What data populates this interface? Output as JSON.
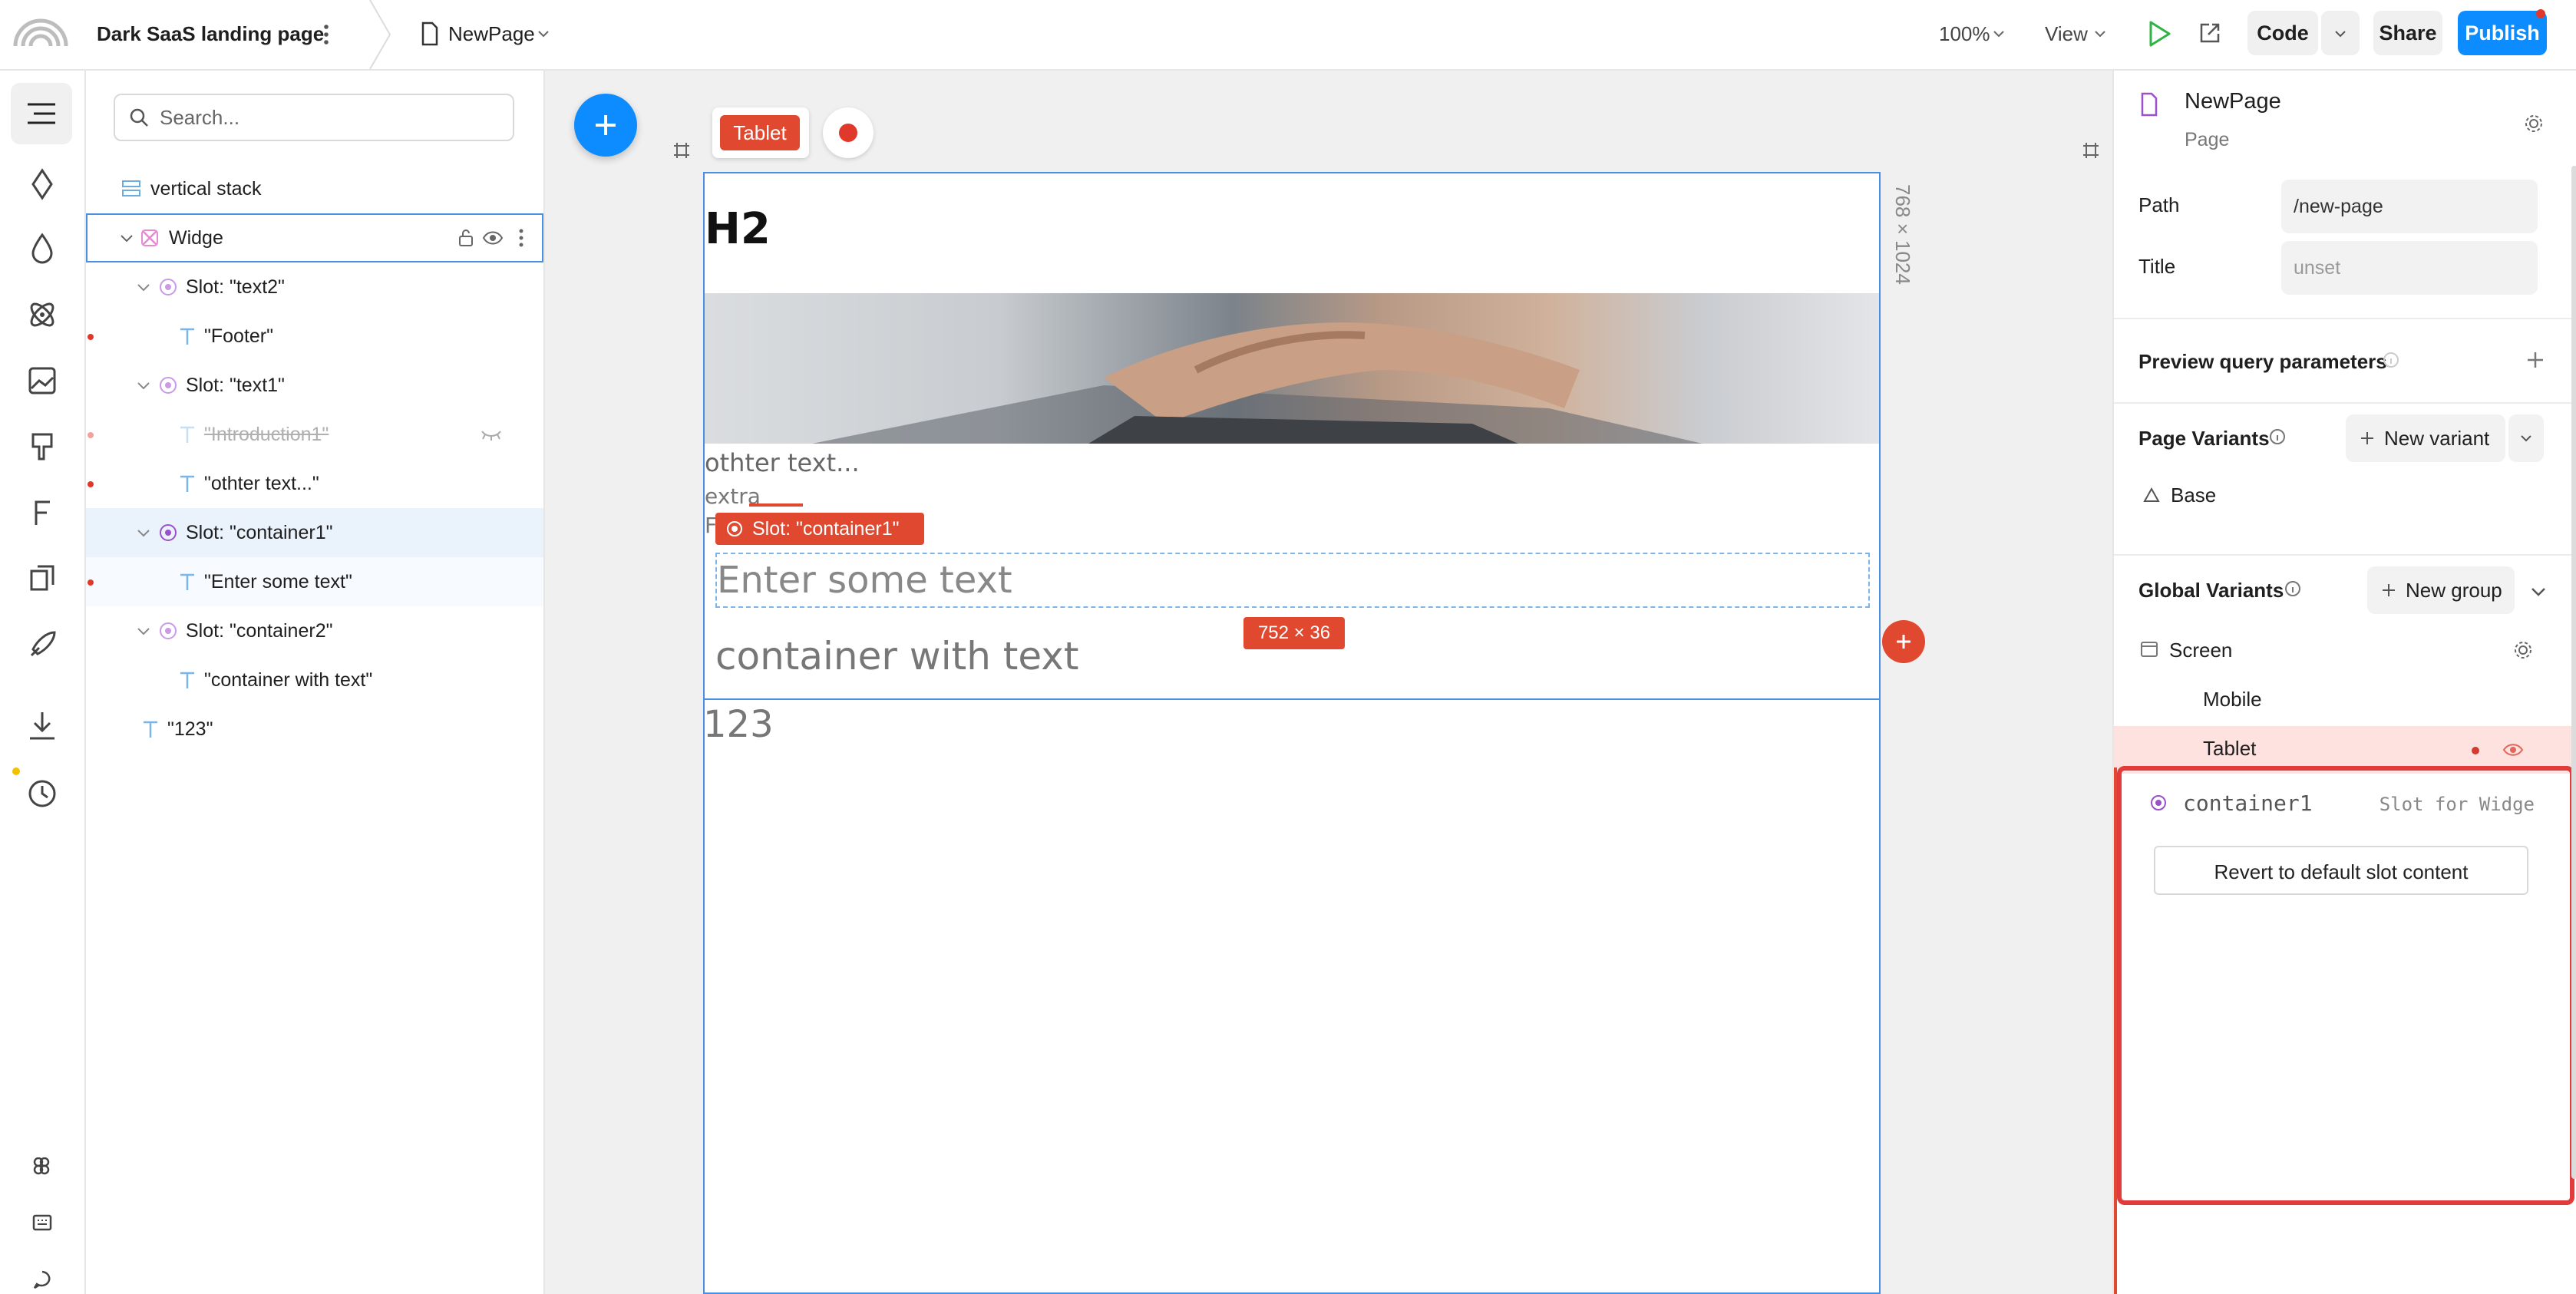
{
  "topbar": {
    "project_name": "Dark SaaS landing page",
    "page_name": "NewPage",
    "zoom": "100%",
    "view_label": "View",
    "code_label": "Code",
    "share_label": "Share",
    "publish_label": "Publish"
  },
  "layers": {
    "search_placeholder": "Search...",
    "items": [
      {
        "label": "vertical stack"
      },
      {
        "label": "Widge"
      },
      {
        "label": "Slot: \"text2\""
      },
      {
        "label": "\"Footer\""
      },
      {
        "label": "Slot: \"text1\""
      },
      {
        "label": "\"Introduction1\""
      },
      {
        "label": "\"othter text...\""
      },
      {
        "label": "Slot: \"container1\""
      },
      {
        "label": "\"Enter some text\""
      },
      {
        "label": "Slot: \"container2\""
      },
      {
        "label": "\"container with text\""
      },
      {
        "label": "\"123\""
      }
    ]
  },
  "canvas": {
    "variant_badge": "Tablet",
    "dimension_label": "768 × 1024",
    "heading": "H2",
    "text_other": "othter text...",
    "text_extra": "extra",
    "text_f": "F",
    "slot_tag": "Slot: \"container1\"",
    "input_text": "Enter some text",
    "size_badge": "752 × 36",
    "container_text": "container with text",
    "number_text": "123"
  },
  "right_panel": {
    "page_title": "NewPage",
    "page_type": "Page",
    "path_label": "Path",
    "path_value": "/new-page",
    "title_label": "Title",
    "title_value": "unset",
    "preview_query_label": "Preview query parameters",
    "page_variants_label": "Page Variants",
    "new_variant_label": "New variant",
    "base_label": "Base",
    "global_variants_label": "Global Variants",
    "new_group_label": "New group",
    "screen_label": "Screen",
    "mobile_label": "Mobile",
    "tablet_label": "Tablet",
    "slot_name": "container1",
    "slot_for": "Slot for Widge",
    "revert_label": "Revert to default slot content"
  },
  "colors": {
    "accent_blue": "#0d8cff",
    "slot_red": "#e0492f",
    "selection_blue": "#4a90e2",
    "slot_purple": "#b06ad9",
    "tablet_highlight": "#fde2e0"
  }
}
